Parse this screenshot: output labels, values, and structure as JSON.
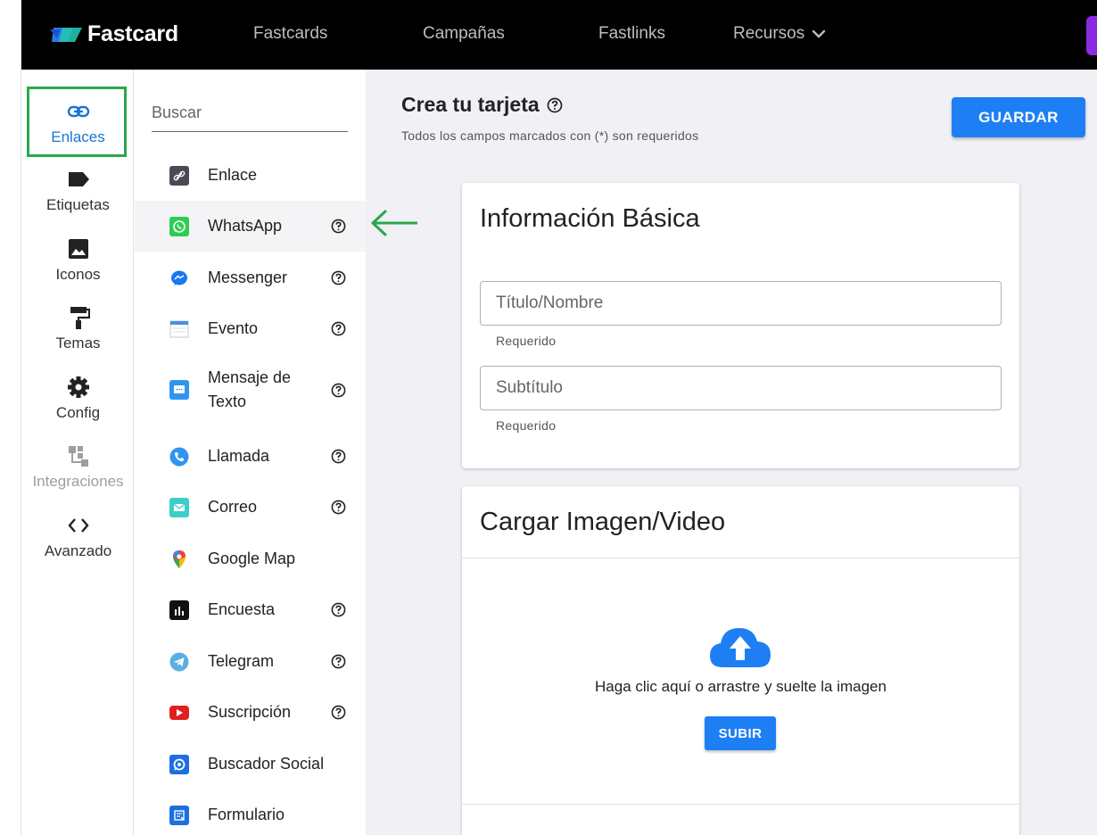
{
  "brand": {
    "name": "Fastcard"
  },
  "topnav": {
    "items": [
      "Fastcards",
      "Campañas",
      "Fastlinks"
    ],
    "recursos": "Recursos"
  },
  "rail": {
    "items": [
      {
        "label": "Enlaces",
        "icon": "link-icon",
        "state": "active"
      },
      {
        "label": "Etiquetas",
        "icon": "label-icon",
        "state": "normal"
      },
      {
        "label": "Iconos",
        "icon": "image-icon",
        "state": "normal"
      },
      {
        "label": "Temas",
        "icon": "paint-roller-icon",
        "state": "normal"
      },
      {
        "label": "Config",
        "icon": "gear-icon",
        "state": "normal"
      },
      {
        "label": "Integraciones",
        "icon": "integrations-icon",
        "state": "disabled"
      },
      {
        "label": "Avanzado",
        "icon": "code-icon",
        "state": "normal"
      }
    ]
  },
  "panel": {
    "search_placeholder": "Buscar",
    "items": [
      {
        "label": "Enlace",
        "icon": "link-icon",
        "help": false
      },
      {
        "label": "WhatsApp",
        "icon": "whatsapp-icon",
        "help": true
      },
      {
        "label": "Messenger",
        "icon": "messenger-icon",
        "help": true
      },
      {
        "label": "Evento",
        "icon": "calendar-icon",
        "help": true
      },
      {
        "label": "Mensaje de Texto",
        "line1": "Mensaje de",
        "line2": "Texto",
        "icon": "sms-icon",
        "help": true
      },
      {
        "label": "Llamada",
        "icon": "phone-icon",
        "help": true
      },
      {
        "label": "Correo",
        "icon": "mail-icon",
        "help": true
      },
      {
        "label": "Google Map",
        "icon": "map-pin-icon",
        "help": false
      },
      {
        "label": "Encuesta",
        "icon": "poll-icon",
        "help": true
      },
      {
        "label": "Telegram",
        "icon": "telegram-icon",
        "help": true
      },
      {
        "label": "Suscripción",
        "icon": "youtube-icon",
        "help": true
      },
      {
        "label": "Buscador Social",
        "icon": "social-search-icon",
        "help": false
      },
      {
        "label": "Formulario",
        "icon": "form-icon",
        "help": false
      }
    ]
  },
  "main": {
    "title": "Crea tu tarjeta",
    "subtitle": "Todos los campos marcados con (*) son requeridos",
    "save_label": "GUARDAR",
    "basic": {
      "title": "Información Básica",
      "title_field_placeholder": "Título/Nombre",
      "title_hint": "Requerido",
      "subtitle_field_placeholder": "Subtítulo",
      "subtitle_hint": "Requerido"
    },
    "upload": {
      "title": "Cargar Imagen/Video",
      "text": "Haga clic aquí o arrastre y suelte la imagen",
      "button": "SUBIR"
    }
  },
  "colors": {
    "accent": "#1e7ff5",
    "highlight_box": "#2aa84a",
    "topbar": "#000000"
  }
}
